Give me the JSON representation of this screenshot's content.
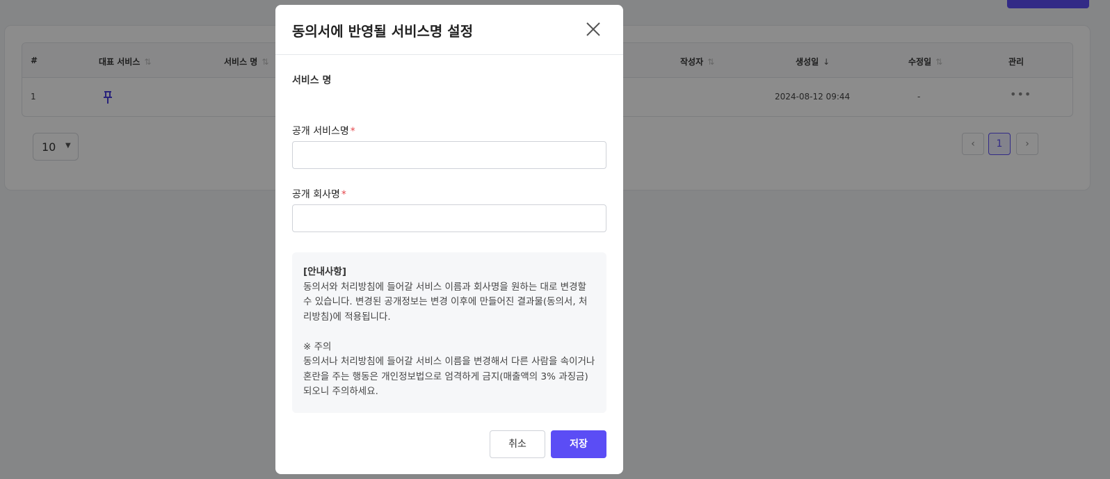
{
  "background": {
    "page_title": "",
    "table": {
      "headers": [
        "#",
        "대표 서비스",
        "서비스 명",
        "작성자",
        "생성일",
        "수정일",
        "관리"
      ],
      "rows": [
        {
          "index": "1",
          "created": "2024-08-12 09:44",
          "modified": "-"
        }
      ]
    },
    "pagination": {
      "page_size": "10",
      "current_page": "1",
      "prev": "‹",
      "next": "›"
    }
  },
  "modal": {
    "title": "동의서에 반영될 서비스명 설정",
    "section_label": "서비스 명",
    "fields": {
      "public_service_name_label": "공개 서비스명",
      "public_company_name_label": "공개 회사명",
      "required_mark": "*",
      "public_service_name_value": "",
      "public_company_name_value": ""
    },
    "notice": {
      "title": "[안내사항]",
      "para1": "동의서와 처리방침에 들어갈 서비스 이름과 회사명을 원하는 대로 변경할 수 있습니다. 변경된 공개정보는 변경 이후에 만들어진 결과물(동의서, 처리방침)에 적용됩니다.",
      "caution_title": "※ 주의",
      "para2": "동의서나 처리방침에 들어갈 서비스 이름을 변경해서 다른 사람을 속이거나 혼란을 주는 행동은 개인정보법으로 엄격하게 금지(매출액의 3% 과징금)되오니 주의하세요."
    },
    "buttons": {
      "cancel": "취소",
      "save": "저장"
    }
  },
  "colors": {
    "accent": "#5b4df5",
    "required": "#e5484d",
    "overlay": "rgba(0,0,0,0.45)"
  },
  "icons": {
    "close": "close-icon",
    "pin": "pin-icon",
    "sort": "sort-icon",
    "sort_desc": "arrow-down-icon",
    "more": "more-dots-icon",
    "caret": "caret-down-icon"
  }
}
